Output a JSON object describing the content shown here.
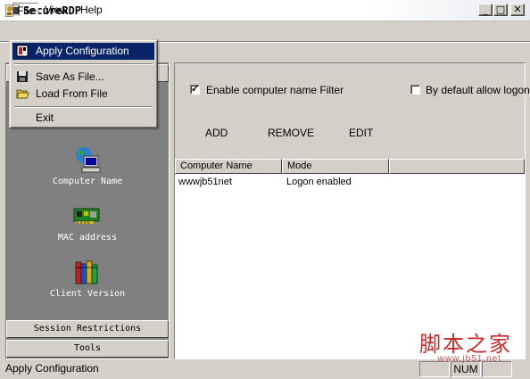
{
  "window": {
    "title": "SecureRDP",
    "minimize": "_",
    "maximize": "□",
    "close": "✕"
  },
  "menu": {
    "file": "File",
    "view": "View",
    "help": "Help"
  },
  "file_menu": {
    "apply": "Apply Configuration",
    "save_as": "Save As File...",
    "load": "Load From File",
    "exit": "Exit"
  },
  "nav": {
    "computer_name": "Computer Name",
    "mac_address": "MAC address",
    "client_version": "Client Version"
  },
  "sections": {
    "session_restrictions": "Session Restrictions",
    "tools": "Tools"
  },
  "filter": {
    "enable_label": "Enable computer name Filter",
    "enable_checked": true,
    "default_allow_label": "By default allow logon",
    "default_allow_checked": false
  },
  "actions": {
    "add": "ADD",
    "remove": "REMOVE",
    "edit": "EDIT"
  },
  "table": {
    "columns": [
      "Computer Name",
      "Mode"
    ],
    "rows": [
      {
        "computer": "wwwjb51net",
        "mode": "Logon enabled"
      }
    ]
  },
  "status": {
    "message": "Apply Configuration",
    "num": "NUM"
  },
  "watermark": {
    "text": "脚本之家",
    "url": "www.jb51.net"
  }
}
